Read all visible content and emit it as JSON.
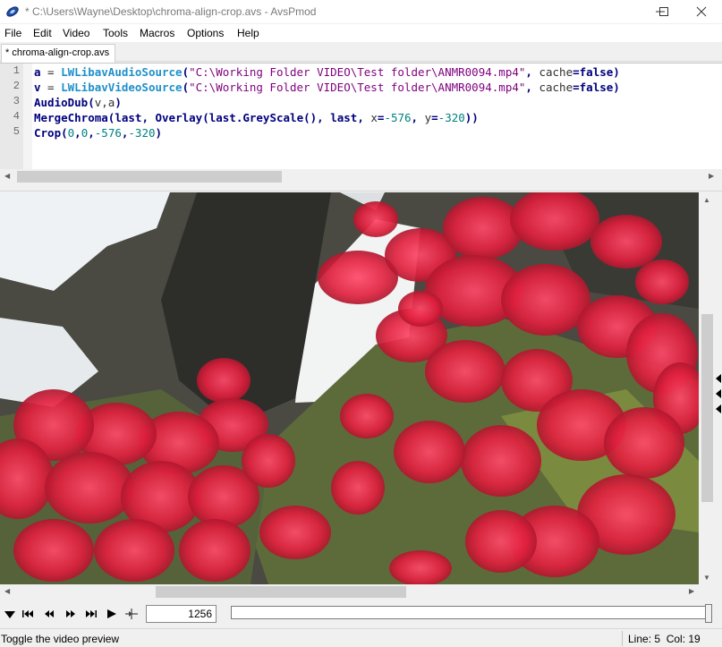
{
  "window": {
    "title": "* C:\\Users\\Wayne\\Desktop\\chroma-align-crop.avs - AvsPmod"
  },
  "menu": {
    "items": [
      "File",
      "Edit",
      "Video",
      "Tools",
      "Macros",
      "Options",
      "Help"
    ]
  },
  "tabs": [
    {
      "label": "* chroma-align-crop.avs"
    }
  ],
  "editor": {
    "line_numbers": [
      "1",
      "2",
      "3",
      "4",
      "5"
    ],
    "lines": [
      [
        [
          "kw",
          "a"
        ],
        [
          "plain",
          " = "
        ],
        [
          "fn",
          "LWLibavAudioSource"
        ],
        [
          "op",
          "("
        ],
        [
          "str",
          "\"C:\\Working Folder VIDEO\\Test folder\\ANMR0094.mp4\""
        ],
        [
          "op",
          ", "
        ],
        [
          "plain",
          "cache"
        ],
        [
          "op",
          "="
        ],
        [
          "kw",
          "false"
        ],
        [
          "op",
          ")"
        ]
      ],
      [
        [
          "kw",
          "v"
        ],
        [
          "plain",
          " = "
        ],
        [
          "fn",
          "LWLibavVideoSource"
        ],
        [
          "op",
          "("
        ],
        [
          "str",
          "\"C:\\Working Folder VIDEO\\Test folder\\ANMR0094.mp4\""
        ],
        [
          "op",
          ", "
        ],
        [
          "plain",
          "cache"
        ],
        [
          "op",
          "="
        ],
        [
          "kw",
          "false"
        ],
        [
          "op",
          ")"
        ]
      ],
      [
        [
          "kw",
          "AudioDub"
        ],
        [
          "op",
          "("
        ],
        [
          "plain",
          "v,a"
        ],
        [
          "op",
          ")"
        ]
      ],
      [
        [
          "kw",
          "MergeChroma"
        ],
        [
          "op",
          "("
        ],
        [
          "kw",
          "last"
        ],
        [
          "op",
          ", "
        ],
        [
          "kw",
          "Overlay"
        ],
        [
          "op",
          "("
        ],
        [
          "kw",
          "last"
        ],
        [
          "op",
          "."
        ],
        [
          "kw",
          "GreyScale"
        ],
        [
          "op",
          "(), "
        ],
        [
          "kw",
          "last"
        ],
        [
          "op",
          ", "
        ],
        [
          "plain",
          "x"
        ],
        [
          "op",
          "="
        ],
        [
          "num",
          "-576"
        ],
        [
          "op",
          ", "
        ],
        [
          "plain",
          "y"
        ],
        [
          "op",
          "="
        ],
        [
          "num",
          "-320"
        ],
        [
          "op",
          "))"
        ]
      ],
      [
        [
          "kw",
          "Crop"
        ],
        [
          "op",
          "("
        ],
        [
          "num",
          "0"
        ],
        [
          "op",
          ","
        ],
        [
          "num",
          "0"
        ],
        [
          "op",
          ","
        ],
        [
          "num",
          "-576"
        ],
        [
          "op",
          ","
        ],
        [
          "num",
          "-320"
        ],
        [
          "op",
          ")"
        ]
      ]
    ]
  },
  "playback": {
    "frame_number": "1256",
    "icons": [
      "play-down-icon",
      "go-to-start-icon",
      "previous-frame-icon",
      "next-frame-icon",
      "go-to-end-icon",
      "play-icon",
      "crosshair-icon"
    ]
  },
  "status": {
    "message": "Toggle the video preview",
    "position": "Line: 5  Col: 19"
  }
}
